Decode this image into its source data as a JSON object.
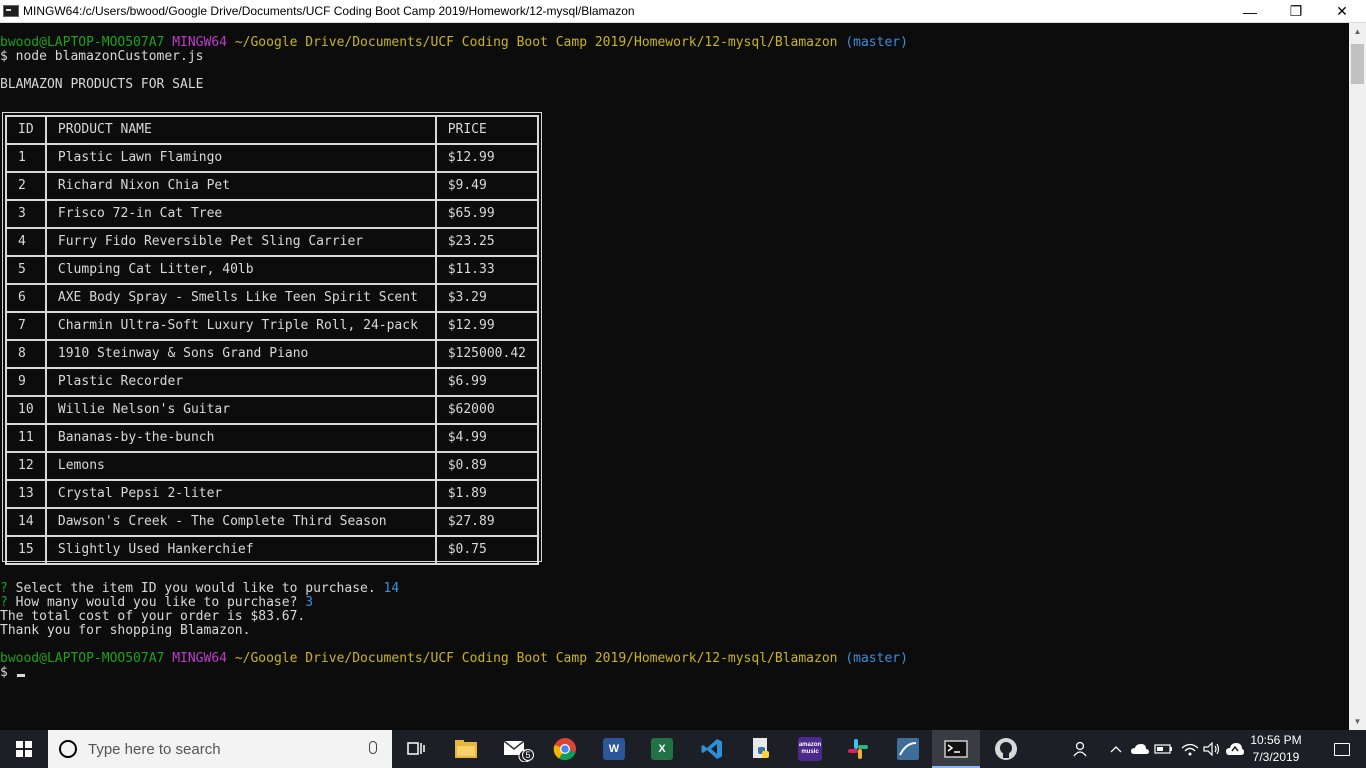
{
  "window": {
    "title": "MINGW64:/c/Users/bwood/Google Drive/Documents/UCF Coding Boot Camp 2019/Homework/12-mysql/Blamazon",
    "min_glyph": "—",
    "max_glyph": "❐",
    "close_glyph": "✕"
  },
  "terminal": {
    "prompt1": {
      "user": "bwood@LAPTOP-MOO507A7",
      "env": "MINGW64",
      "path": "~/Google Drive/Documents/UCF Coding Boot Camp 2019/Homework/12-mysql/Blamazon",
      "branch": "(master)"
    },
    "command": "$ node blamazonCustomer.js",
    "heading": "BLAMAZON PRODUCTS FOR SALE",
    "table": {
      "headers": [
        "ID",
        "PRODUCT NAME",
        "PRICE"
      ],
      "rows": [
        [
          "1",
          "Plastic Lawn Flamingo",
          "$12.99"
        ],
        [
          "2",
          "Richard Nixon Chia Pet",
          "$9.49"
        ],
        [
          "3",
          "Frisco 72-in Cat Tree",
          "$65.99"
        ],
        [
          "4",
          "Furry Fido Reversible Pet Sling Carrier",
          "$23.25"
        ],
        [
          "5",
          "Clumping Cat Litter, 40lb",
          "$11.33"
        ],
        [
          "6",
          "AXE Body Spray - Smells Like Teen Spirit Scent",
          "$3.29"
        ],
        [
          "7",
          "Charmin Ultra-Soft Luxury Triple Roll, 24-pack",
          "$12.99"
        ],
        [
          "8",
          "1910 Steinway & Sons Grand Piano",
          "$125000.42"
        ],
        [
          "9",
          "Plastic Recorder",
          "$6.99"
        ],
        [
          "10",
          "Willie Nelson's Guitar",
          "$62000"
        ],
        [
          "11",
          "Bananas-by-the-bunch",
          "$4.99"
        ],
        [
          "12",
          "Lemons",
          "$0.89"
        ],
        [
          "13",
          "Crystal Pepsi 2-liter",
          "$1.89"
        ],
        [
          "14",
          "Dawson's Creek - The Complete Third Season",
          "$27.89"
        ],
        [
          "15",
          "Slightly Used Hankerchief",
          "$0.75"
        ]
      ]
    },
    "q1": {
      "mark": "?",
      "text": "Select the item ID you would like to purchase.",
      "answer": "14"
    },
    "q2": {
      "mark": "?",
      "text": "How many would you like to purchase?",
      "answer": "3"
    },
    "total_line": "The total cost of your order is $83.67.",
    "thanks_line": "Thank you for shopping Blamazon.",
    "prompt2": {
      "user": "bwood@LAPTOP-MOO507A7",
      "env": "MINGW64",
      "path": "~/Google Drive/Documents/UCF Coding Boot Camp 2019/Homework/12-mysql/Blamazon",
      "branch": "(master)"
    },
    "final_prompt": "$",
    "colors": {
      "user": "#1fa01f",
      "env": "#b93cc6",
      "path": "#c8b420",
      "branch": "#3b8fd8"
    }
  },
  "taskbar": {
    "search_placeholder": "Type here to search",
    "mail_badge": "5",
    "amazon_music_label": "amazon music",
    "time": "10:56 PM",
    "date": "7/3/2019"
  }
}
